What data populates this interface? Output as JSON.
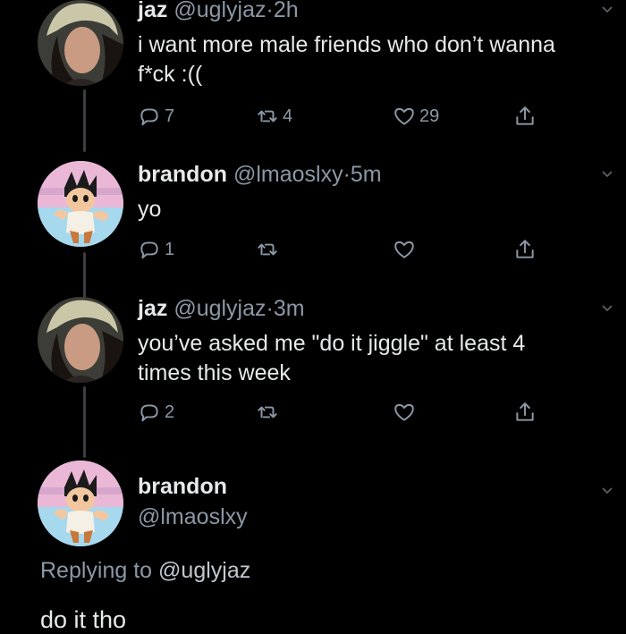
{
  "tweets": [
    {
      "name": "jaz",
      "handle": "@uglyjaz",
      "time": "2h",
      "text_line1": "i want more male friends who don’t wanna",
      "text_line2": "f*ck :((",
      "replies": "7",
      "retweets": "4",
      "likes": "29"
    },
    {
      "name": "brandon",
      "handle": "@lmaoslxy",
      "time": "5m",
      "text_line1": "yo",
      "replies": "1",
      "retweets": "",
      "likes": ""
    },
    {
      "name": "jaz",
      "handle": "@uglyjaz",
      "time": "3m",
      "text_line1": "you’ve asked me \"do it jiggle\" at least 4",
      "text_line2": "times this week",
      "replies": "2",
      "retweets": "",
      "likes": ""
    }
  ],
  "main_tweet": {
    "name": "brandon",
    "handle": "@lmaoslxy",
    "replying_prefix": "Replying to ",
    "replying_handle": "@uglyjaz",
    "text": "do it tho"
  },
  "separator": "·",
  "icons": {
    "reply": "reply-icon",
    "retweet": "retweet-icon",
    "like": "heart-icon",
    "share": "share-icon",
    "menu": "chevron-down-icon"
  },
  "colors": {
    "background": "#000000",
    "text": "#e7e9ea",
    "secondary": "#8b98a5",
    "thread_line": "#3a3f44"
  }
}
